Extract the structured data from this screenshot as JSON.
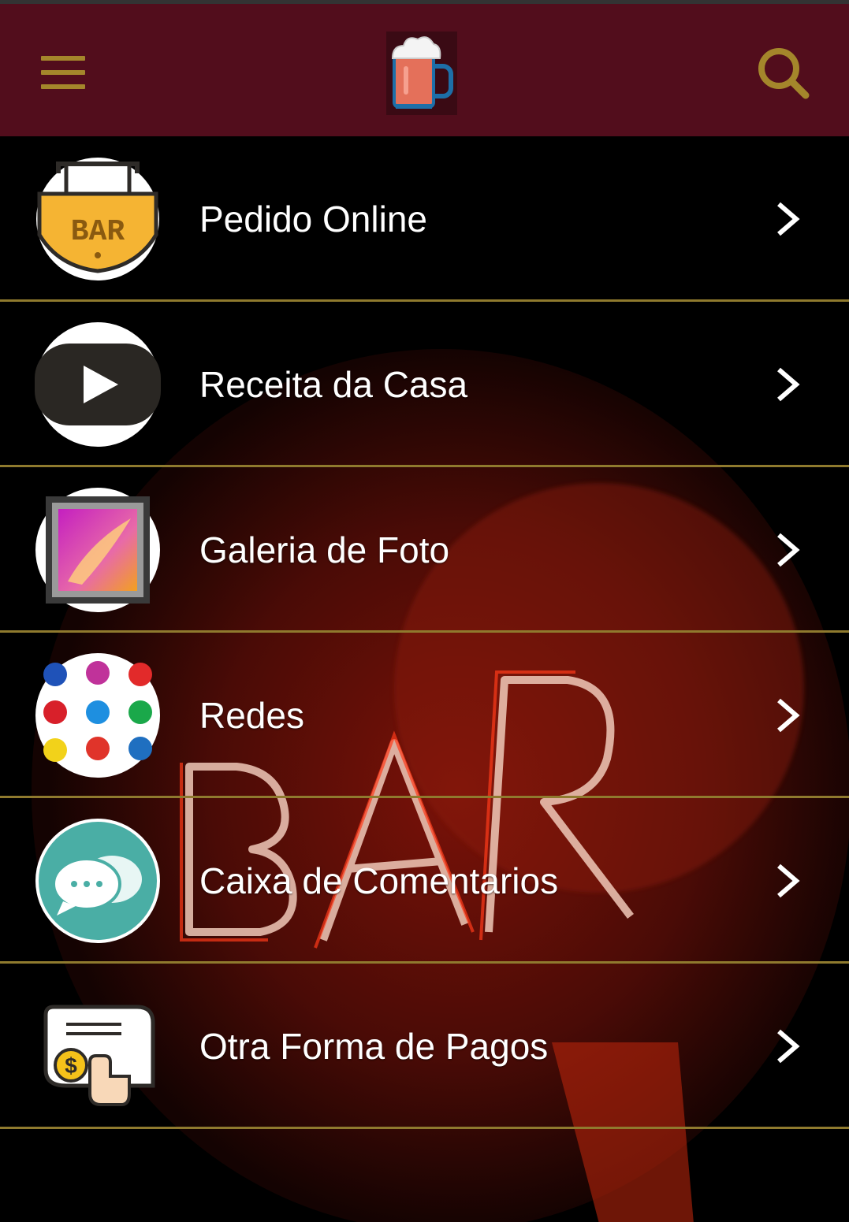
{
  "header": {
    "logo_icon": "beer-mug-icon",
    "menu_icon": "hamburger-menu-icon",
    "search_icon": "search-icon",
    "bar_color": "#520d1c",
    "accent_color": "#a4862b"
  },
  "menu": {
    "items": [
      {
        "label": "Pedido Online",
        "icon": "bar-sign-icon"
      },
      {
        "label": "Receita da Casa",
        "icon": "play-video-icon"
      },
      {
        "label": "Galeria de Foto",
        "icon": "photo-frame-icon"
      },
      {
        "label": "Redes",
        "icon": "social-networks-icon"
      },
      {
        "label": "Caixa de Comentarios",
        "icon": "chat-bubbles-icon"
      },
      {
        "label": "Otra Forma de Pagos",
        "icon": "payment-receipt-icon"
      }
    ]
  }
}
